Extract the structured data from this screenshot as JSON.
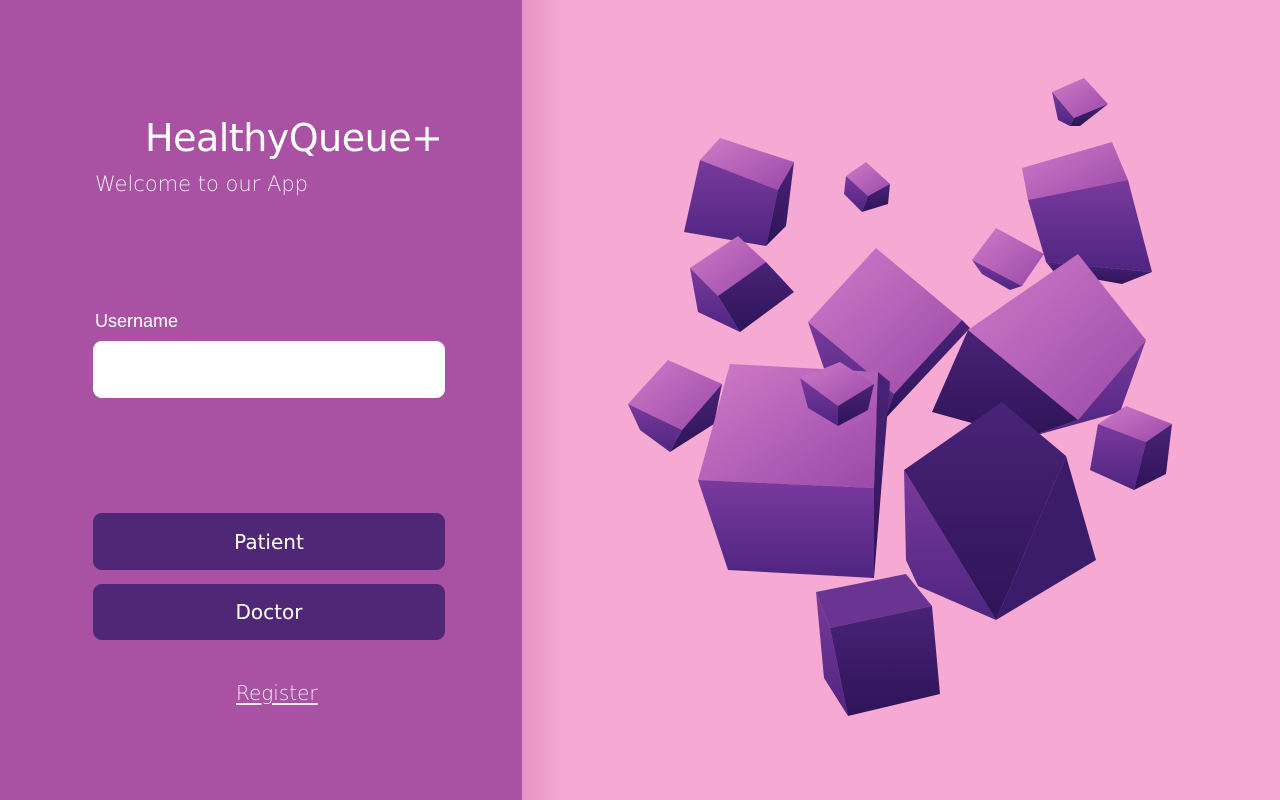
{
  "app": {
    "title": "HealthyQueue+",
    "subtitle": "Welcome to our App"
  },
  "login": {
    "username_label": "Username",
    "username_value": "",
    "username_placeholder": ""
  },
  "roles": {
    "patient_label": "Patient",
    "doctor_label": "Doctor"
  },
  "links": {
    "register_label": "Register"
  },
  "colors": {
    "left_panel": "#a952a3",
    "right_panel": "#f6a9d2",
    "button": "#502676",
    "cube_dark": "#3d1f6e",
    "cube_mid": "#6a3592",
    "cube_light": "#b65cb6"
  },
  "illustration": {
    "name": "floating-purple-cubes"
  }
}
